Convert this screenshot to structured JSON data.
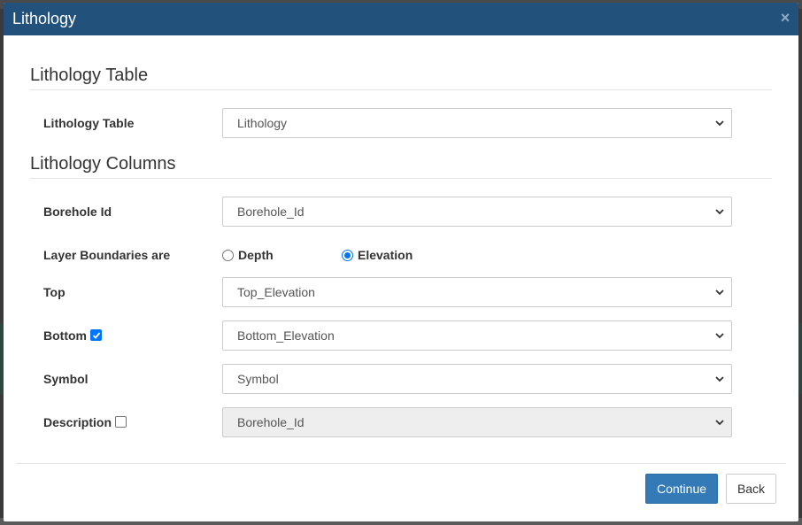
{
  "dialog": {
    "title": "Lithology",
    "close_icon": "×"
  },
  "sections": {
    "table_heading": "Lithology Table",
    "columns_heading": "Lithology Columns"
  },
  "fields": {
    "lithology_table": {
      "label": "Lithology Table",
      "value": "Lithology"
    },
    "borehole_id": {
      "label": "Borehole Id",
      "value": "Borehole_Id"
    },
    "layer_boundaries": {
      "label": "Layer Boundaries are",
      "options": [
        "Depth",
        "Elevation"
      ],
      "selected": "Elevation"
    },
    "top": {
      "label": "Top",
      "value": "Top_Elevation"
    },
    "bottom": {
      "label": "Bottom",
      "checked": true,
      "value": "Bottom_Elevation"
    },
    "symbol": {
      "label": "Symbol",
      "value": "Symbol"
    },
    "description": {
      "label": "Description",
      "checked": false,
      "value": "Borehole_Id",
      "disabled": true
    }
  },
  "buttons": {
    "continue": "Continue",
    "back": "Back"
  },
  "colors": {
    "header": "#22527b",
    "primary": "#337ab7",
    "check_accent": "#0075ff"
  }
}
